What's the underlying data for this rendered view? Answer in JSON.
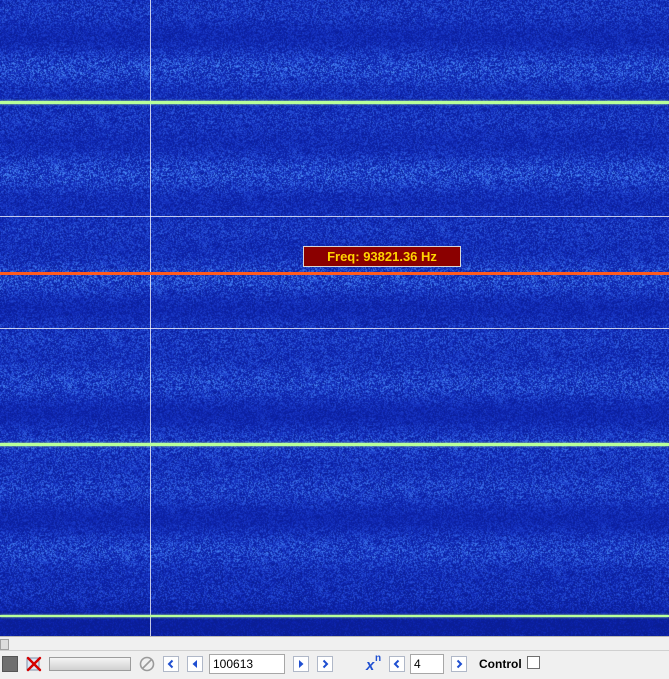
{
  "spectrogram": {
    "background_color": "#1a3fd6",
    "signal_color": "#b8ff9a",
    "marker_color": "#ff5a1e",
    "grid_color": "#ffffff",
    "freq_readout": "Freq: 93821.36 Hz"
  },
  "toolbar": {
    "sample_position": "100613",
    "power_value": "4",
    "power_label": "x",
    "power_superscript": "n",
    "control_label": "Control",
    "control_checked": false
  },
  "icons": {
    "stop": "stop-icon",
    "clear": "clear-icon",
    "disabled": "no-entry-icon",
    "first": "chevron-left-icon",
    "prev": "triangle-left-icon",
    "next": "triangle-right-icon",
    "last": "chevron-right-icon"
  }
}
